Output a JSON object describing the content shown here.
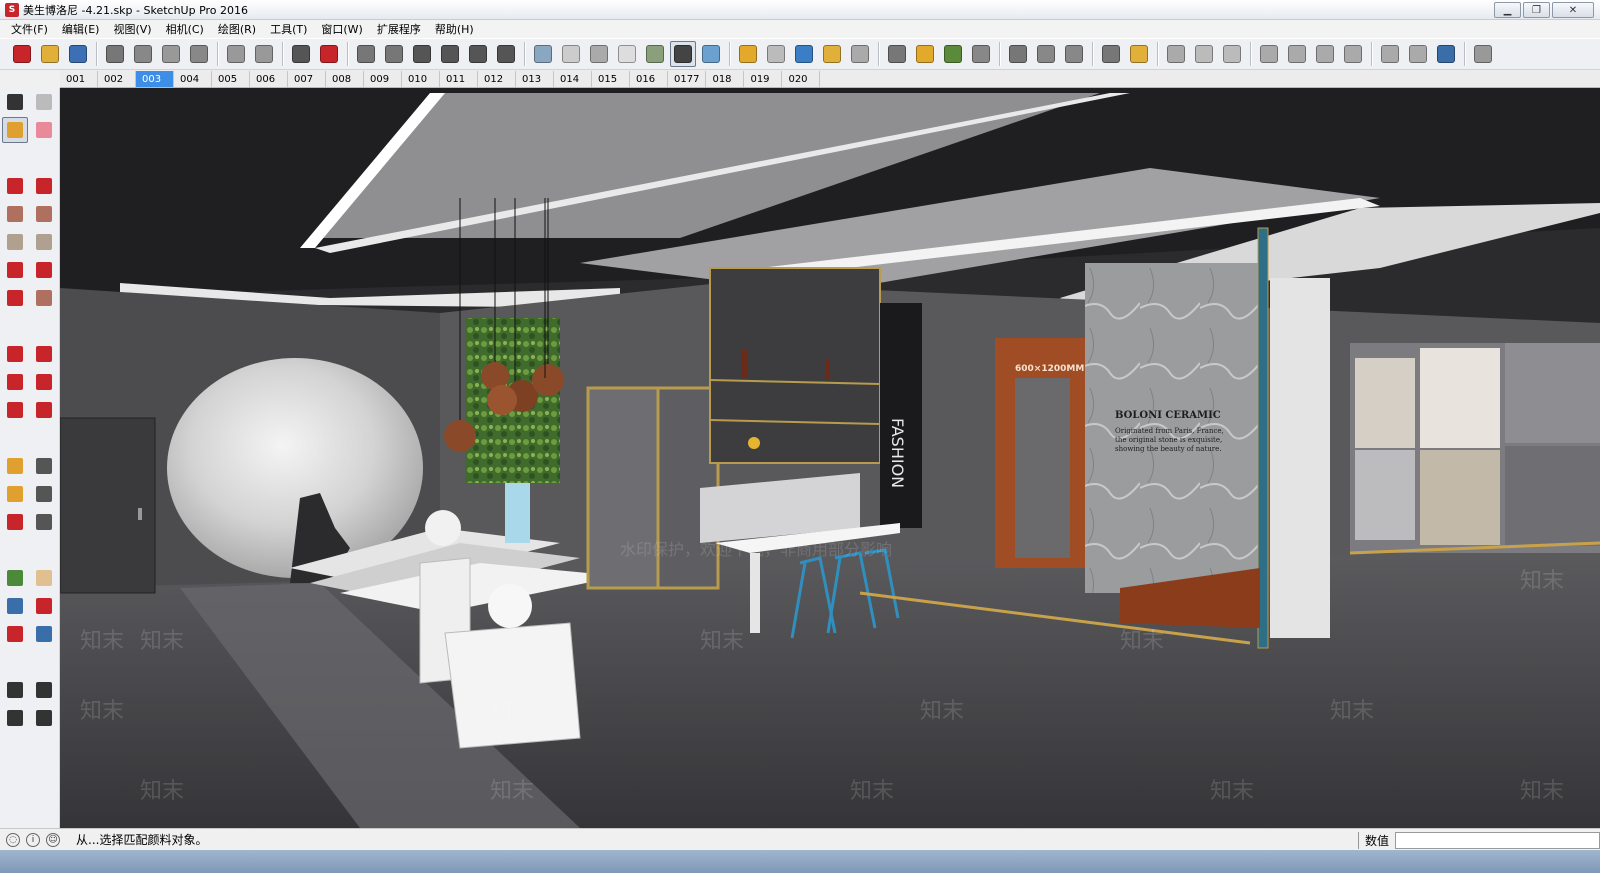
{
  "window": {
    "title": "美生博洛尼 -4.21.skp - SketchUp Pro 2016",
    "app_icon": "sketchup-icon",
    "controls": [
      "minimize-icon",
      "restore-icon",
      "close-icon"
    ]
  },
  "menu": [
    "文件(F)",
    "编辑(E)",
    "视图(V)",
    "相机(C)",
    "绘图(R)",
    "工具(T)",
    "窗口(W)",
    "扩展程序",
    "帮助(H)"
  ],
  "scenes": {
    "tabs": [
      "001",
      "002",
      "003",
      "004",
      "005",
      "006",
      "007",
      "008",
      "009",
      "010",
      "011",
      "012",
      "013",
      "014",
      "015",
      "016",
      "0177",
      "018",
      "019",
      "020"
    ],
    "selected": "003"
  },
  "viewport": {
    "sign_size": "600×1200MM",
    "brand_title": "BOLONI CERAMIC",
    "brand_text": [
      "Originated from Paris, France,",
      "the original stone is exquisite,",
      "showing the beauty of nature."
    ],
    "poster_text": "FASHION",
    "watermark": "知末",
    "watermark_line": "水印保护，欢迎下载，非商用部分影响"
  },
  "status": {
    "message": "从...选择匹配颜料对象。",
    "measurements_label": "数值"
  },
  "colors": {
    "selected_scene": "#3d8ee6",
    "sketchup_red": "#c8252b"
  }
}
